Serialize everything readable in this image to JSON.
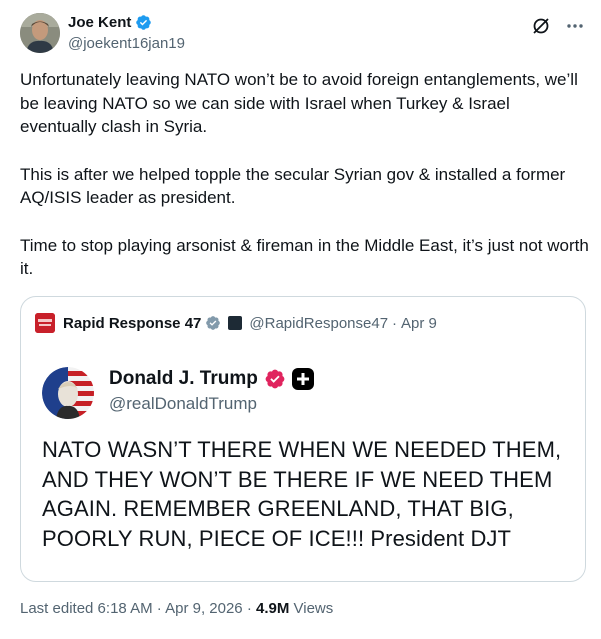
{
  "author": {
    "name": "Joe Kent",
    "handle": "@joekent16jan19"
  },
  "icons": {
    "verified": "verified-badge-icon",
    "grok": "grok-slash-icon",
    "more": "more-dots-icon"
  },
  "colors": {
    "verified_blue": "#1d9bf0",
    "secondary_text": "#536471",
    "border": "#cfd9de",
    "pink_badge": "#e0245e"
  },
  "tweet": {
    "paragraphs": [
      "Unfortunately leaving NATO won’t be to avoid foreign entanglements, we’ll be leaving NATO so we can side with Israel when Turkey & Israel eventually clash in Syria.",
      "This is after we helped topple the secular Syrian gov & installed a former AQ/ISIS leader as president.",
      "Time to stop playing arsonist & fireman in the Middle East, it’s just not worth it."
    ]
  },
  "quote": {
    "name": "Rapid Response 47",
    "handle": "@RapidResponse47",
    "dot": "·",
    "date": "Apr 9",
    "inner": {
      "name": "Donald J. Trump",
      "handle": "@realDonaldTrump",
      "text": "NATO WASN’T THERE WHEN WE NEEDED THEM, AND THEY WON’T BE THERE IF WE NEED THEM AGAIN. REMEMBER GREENLAND, THAT BIG, POORLY RUN, PIECE OF ICE!!! President DJT"
    }
  },
  "meta": {
    "edited": "Last edited 6:18 AM · Apr 9, 2026 · ",
    "views_count": "4.9M",
    "views_label": " Views"
  }
}
